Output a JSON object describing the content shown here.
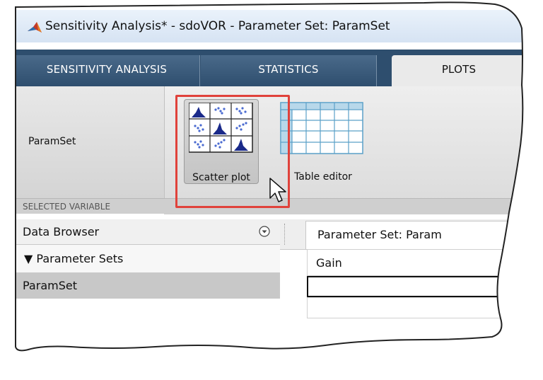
{
  "window": {
    "title": "Sensitivity Analysis* - sdoVOR - Parameter Set:  ParamSet",
    "app_icon": "matlab-icon"
  },
  "tabs": [
    {
      "label": "SENSITIVITY ANALYSIS",
      "active": false
    },
    {
      "label": "STATISTICS",
      "active": false
    },
    {
      "label": "PLOTS",
      "active": true
    }
  ],
  "ribbon": {
    "variable_value": "ParamSet",
    "section_label": "SELECTED VARIABLE",
    "buttons": [
      {
        "label": "Scatter plot",
        "icon": "scatter-plot-icon",
        "highlighted": true
      },
      {
        "label": "Table editor",
        "icon": "table-editor-icon",
        "highlighted": false
      }
    ]
  },
  "data_browser": {
    "title": "Data Browser",
    "collapse_icon": "collapse-circle-icon",
    "section_label": "▼ Parameter Sets",
    "items": [
      {
        "label": "ParamSet",
        "selected": true
      }
    ]
  },
  "document": {
    "tab_label": "Parameter Set:  Param",
    "table": {
      "columns": [
        "Gain"
      ]
    }
  },
  "colors": {
    "highlight": "#e0423b",
    "tab_bar": "#2e4e6e",
    "selected_row": "#c8c8c8"
  }
}
